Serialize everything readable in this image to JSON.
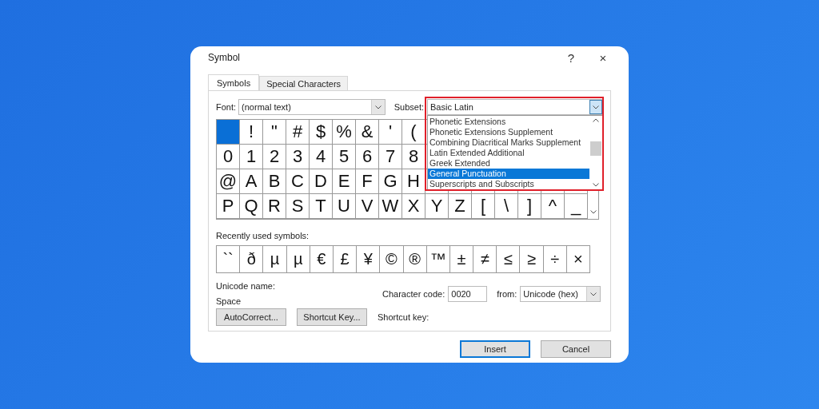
{
  "window": {
    "title": "Symbol",
    "help": "?",
    "close": "×"
  },
  "tabs": [
    {
      "label": "Symbols",
      "selected": true
    },
    {
      "label": "Special Characters",
      "selected": false
    }
  ],
  "font": {
    "label": "Font:",
    "value": "(normal text)"
  },
  "subset": {
    "label": "Subset:",
    "value": "Basic Latin",
    "expanded": true,
    "highlighted": true,
    "options": [
      {
        "label": "Phonetic Extensions",
        "selected": false
      },
      {
        "label": "Phonetic Extensions Supplement",
        "selected": false
      },
      {
        "label": "Combining Diacritical Marks Supplement",
        "selected": false
      },
      {
        "label": "Latin Extended Additional",
        "selected": false
      },
      {
        "label": "Greek Extended",
        "selected": false
      },
      {
        "label": "General Punctuation",
        "selected": true
      },
      {
        "label": "Superscripts and Subscripts",
        "selected": false
      }
    ]
  },
  "symbol_grid": [
    [
      {
        "selected": true
      },
      {
        "char": "!",
        "selected": false
      },
      {
        "char": "\"",
        "selected": false
      },
      {
        "char": "#",
        "selected": false
      },
      {
        "char": "$",
        "selected": false
      },
      {
        "char": "%",
        "selected": false
      },
      {
        "char": "&",
        "selected": false
      },
      {
        "char": "'",
        "selected": false
      },
      {
        "char": "(",
        "selected": false
      }
    ],
    [
      {
        "char": "0",
        "selected": false
      },
      {
        "char": "1",
        "selected": false
      },
      {
        "char": "2",
        "selected": false
      },
      {
        "char": "3",
        "selected": false
      },
      {
        "char": "4",
        "selected": false
      },
      {
        "char": "5",
        "selected": false
      },
      {
        "char": "6",
        "selected": false
      },
      {
        "char": "7",
        "selected": false
      },
      {
        "char": "8",
        "selected": false
      }
    ],
    [
      {
        "char": "@",
        "selected": false
      },
      {
        "char": "A",
        "selected": false
      },
      {
        "char": "B",
        "selected": false
      },
      {
        "char": "C",
        "selected": false
      },
      {
        "char": "D",
        "selected": false
      },
      {
        "char": "E",
        "selected": false
      },
      {
        "char": "F",
        "selected": false
      },
      {
        "char": "G",
        "selected": false
      },
      {
        "char": "H",
        "selected": false
      }
    ],
    [
      {
        "char": "P",
        "selected": false
      },
      {
        "char": "Q",
        "selected": false
      },
      {
        "char": "R",
        "selected": false
      },
      {
        "char": "S",
        "selected": false
      },
      {
        "char": "T",
        "selected": false
      },
      {
        "char": "U",
        "selected": false
      },
      {
        "char": "V",
        "selected": false
      },
      {
        "char": "W",
        "selected": false
      },
      {
        "char": "X",
        "selected": false
      },
      {
        "char": "Y",
        "selected": false
      },
      {
        "char": "Z",
        "selected": false
      },
      {
        "char": "[",
        "selected": false
      },
      {
        "char": "\\",
        "selected": false
      },
      {
        "char": "]",
        "selected": false
      },
      {
        "char": "^",
        "selected": false
      },
      {
        "char": "_",
        "selected": false
      }
    ]
  ],
  "recently_used": {
    "label": "Recently used symbols:",
    "symbols": [
      "``",
      "ð",
      "µ",
      "µ",
      "€",
      "£",
      "¥",
      "©",
      "®",
      "™",
      "±",
      "≠",
      "≤",
      "≥",
      "÷",
      "×"
    ]
  },
  "unicode_name": {
    "label": "Unicode name:",
    "value": "Space"
  },
  "character_code": {
    "label": "Character code:",
    "value": "0020"
  },
  "from": {
    "label": "from:",
    "value": "Unicode (hex)"
  },
  "buttons": [
    "AutoCorrect...",
    "Shortcut Key..."
  ],
  "shortcut_key": {
    "label": "Shortcut key:"
  },
  "footer_buttons": [
    {
      "label": "Insert",
      "kind": "default"
    },
    {
      "label": "Cancel",
      "kind": "plain"
    }
  ]
}
